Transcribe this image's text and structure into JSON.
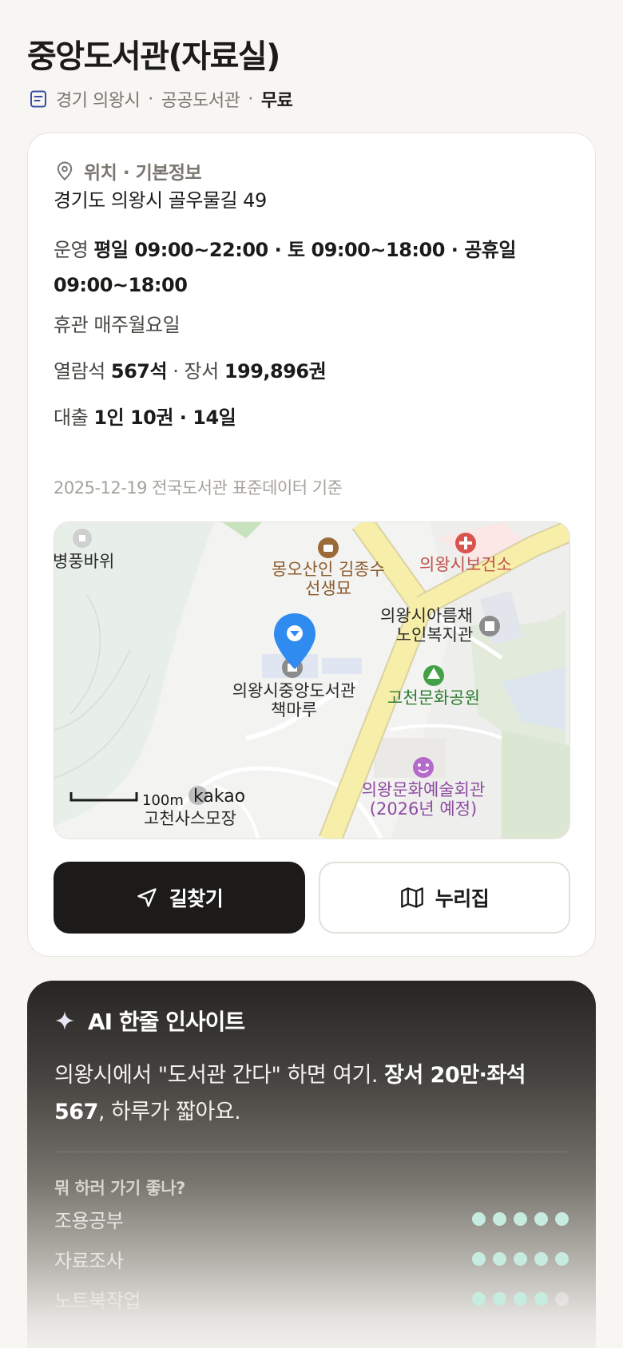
{
  "header": {
    "title": "중앙도서관(자료실)",
    "region": "경기 의왕시",
    "sep1": "·",
    "category": "공공도서관",
    "sep2": "·",
    "fee": "무료"
  },
  "info": {
    "section_title": "위치 · 기본정보",
    "address": "경기도 의왕시 골우물길 49",
    "hours_label": "운영",
    "hours_value": "평일 09:00~22:00 · 토 09:00~18:00 · 공휴일 09:00~18:00",
    "closed_label": "휴관",
    "closed_value": "매주월요일",
    "seats_label": "열람석",
    "seats_value": "567석",
    "seats_sep": "·",
    "books_label": "장서",
    "books_value": "199,896권",
    "loan_label": "대출",
    "loan_value": "1인 10권 · 14일",
    "basis": "2025-12-19 전국도서관 표준데이터 기준"
  },
  "map": {
    "labels": {
      "rock": "병풍바위",
      "tomb_line1": "몽오산인 김종수",
      "tomb_line2": "선생묘",
      "health": "의왕시보건소",
      "welfare_line1": "의왕시아름채",
      "welfare_line2": "노인복지관",
      "park": "고천문화공원",
      "library_line1": "의왕시중앙도서관",
      "library_line2": "책마루",
      "arts_line1": "의왕문화예술회관",
      "arts_line2": "(2026년 예정)",
      "scale": "100m",
      "brand": "kakao",
      "bottom_poi": "고천사스모장"
    },
    "colors": {
      "tomb": "#8b5a2b",
      "health": "#c0504d",
      "park": "#2e7d32",
      "arts": "#8e4ba3",
      "pin": "#2f8bf0"
    }
  },
  "actions": {
    "directions": "길찾기",
    "nurijip": "누리집"
  },
  "ai": {
    "title": "AI 한줄 인사이트",
    "text_plain": "의왕시에서 \"도서관 간다\" 하면 여기. ",
    "text_bold": "장서 20만·좌석 567",
    "text_tail": ", 하루가 짧아요.",
    "question": "뭐 하러 가기 좋나?",
    "ratings": [
      {
        "label": "조용공부",
        "score": 5,
        "max": 5
      },
      {
        "label": "자료조사",
        "score": 5,
        "max": 5
      },
      {
        "label": "노트북작업",
        "score": 4,
        "max": 5
      }
    ]
  }
}
